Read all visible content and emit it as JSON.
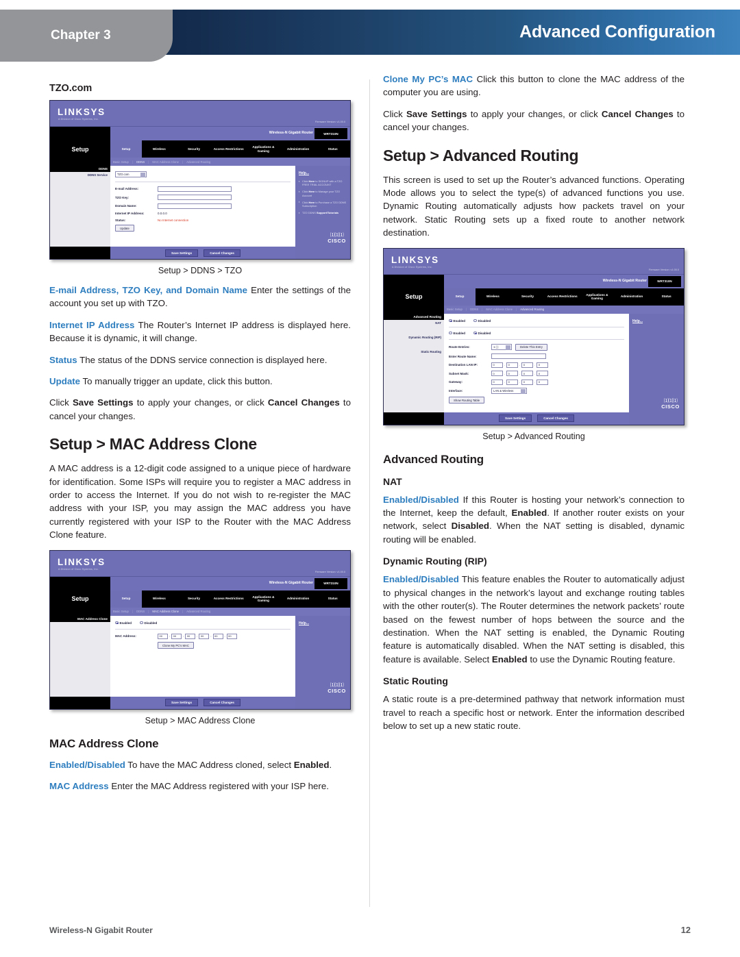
{
  "header": {
    "chapter_label": "Chapter 3",
    "banner_title": "Advanced Configuration",
    "banner_gradient_start": "#12294a",
    "banner_gradient_end": "#3d82bd",
    "chapter_tab_color": "#939598"
  },
  "theme": {
    "accent_blue": "#2e7ebf",
    "body_text": "#231f20",
    "router_purple": "#6f6fb5",
    "status_red": "#d8361f"
  },
  "left_column": {
    "tzo_heading": "TZO.com",
    "tzo_caption": "Setup > DDNS > TZO",
    "p_email": {
      "lead": "E-mail Address, TZO Key, and Domain Name",
      "rest": " Enter the settings of the account you set up with TZO."
    },
    "p_internet_ip": {
      "lead": "Internet IP Address",
      "rest": " The Router’s Internet IP address is displayed here. Because it is dynamic, it will change."
    },
    "p_status": {
      "lead": "Status",
      "rest": " The status of the DDNS service connection is displayed here."
    },
    "p_update": {
      "lead": "Update",
      "rest": "  To manually trigger an update, click this button."
    },
    "p_save": {
      "pre": "Click ",
      "b1": "Save Settings",
      "mid": " to apply your changes, or click ",
      "b2": "Cancel Changes",
      "post": " to cancel your changes."
    },
    "mac_clone_heading": "Setup > MAC Address Clone",
    "mac_clone_intro": "A MAC address is a 12-digit code assigned to a unique piece of hardware for identification. Some ISPs will require you to register a MAC address in order to access the Internet. If you do not wish to re-register the MAC address with your ISP, you may assign the MAC address you have currently registered with your ISP to the Router with the MAC Address Clone feature.",
    "mac_clone_caption": "Setup > MAC Address Clone",
    "mac_clone_subheading": "MAC Address Clone",
    "p_enabled_disabled": {
      "lead": "Enabled/Disabled",
      "mid": " To have the MAC Address cloned, select ",
      "b1": "Enabled",
      "post": "."
    },
    "p_mac_address": {
      "lead": "MAC Address",
      "rest": " Enter the MAC Address registered with your ISP here."
    }
  },
  "right_column": {
    "p_clone_my_pcs_mac": {
      "lead": "Clone My PC’s MAC",
      "rest": "  Click this button to clone the MAC address of the computer you are using."
    },
    "p_save": {
      "pre": "Click ",
      "b1": "Save Settings",
      "mid": " to apply your changes, or click ",
      "b2": "Cancel Changes",
      "post": " to cancel your changes."
    },
    "adv_routing_heading": "Setup > Advanced Routing",
    "adv_routing_intro": "This screen is used to set up the Router’s advanced functions. Operating Mode allows you to select the type(s) of advanced functions you use. Dynamic Routing automatically adjusts how packets travel on your network. Static Routing sets up a fixed route to another network destination.",
    "adv_routing_caption": "Setup > Advanced Routing",
    "adv_routing_subheading": "Advanced Routing",
    "nat_heading": "NAT",
    "p_nat": {
      "lead": "Enabled/Disabled",
      "t1": "  If this Router is hosting your network’s connection to the Internet, keep the default, ",
      "b1": "Enabled",
      "t2": ". If another router exists on your network, select ",
      "b2": "Disabled",
      "t3": ". When the NAT setting is disabled, dynamic routing will be enabled."
    },
    "rip_heading": "Dynamic Routing (RIP)",
    "p_rip": {
      "lead": "Enabled/Disabled",
      "t1": " This feature enables the Router to automatically adjust to physical changes in the network’s layout and exchange routing tables with the other router(s). The Router determines the network packets’ route based on the fewest number of hops between the source and the destination. When the NAT setting is enabled, the Dynamic Routing feature is automatically disabled. When the NAT setting is disabled, this feature is available. Select ",
      "b1": "Enabled",
      "t2": " to use the Dynamic Routing feature."
    },
    "static_routing_heading": "Static Routing",
    "p_static_routing": "A static route is a pre-determined pathway that network information must travel to reach a specific host or network. Enter the information described below to set up a new static route."
  },
  "router_ui": {
    "brand": "LINKSYS",
    "brand_sub": "A Division of Cisco Systems, Inc.",
    "firmware": "Firmware Version: v1.00.0",
    "product_name": "Wireless-N Gigabit Router",
    "model": "WRT310N",
    "section_title": "Setup",
    "tabs": [
      "Setup",
      "Wireless",
      "Security",
      "Access Restrictions",
      "Applications & Gaming",
      "Administration",
      "Status"
    ],
    "subnav": [
      "Basic Setup",
      "DDNS",
      "MAC Address Clone",
      "Advanced Routing"
    ],
    "save_button": "Save Settings",
    "cancel_button": "Cancel Changes",
    "help_title": "Help...",
    "cisco_word": "CISCO"
  },
  "tzo_screen": {
    "side_heading": "DDNS",
    "side_label": "DDNS Service",
    "service_select": "TZO.com",
    "fields": [
      {
        "label": "E-mail Address:",
        "value": ""
      },
      {
        "label": "TZO Key:",
        "value": ""
      },
      {
        "label": "Domain Name:",
        "value": ""
      }
    ],
    "internet_ip_label": "Internet IP Address:",
    "internet_ip_value": "0.0.0.0",
    "status_label": "Status:",
    "status_value": "No Internet connection",
    "update_button": "Update",
    "help_items": [
      {
        "pre": "Click ",
        "b": "Here",
        "post": " to SIGNUP with a TZO FREE TRIAL ACCOUNT"
      },
      {
        "pre": "Click ",
        "b": "Here",
        "post": " to Manage your TZO Account"
      },
      {
        "pre": "Click ",
        "b": "Here",
        "post": " to Purchase a TZO DDNS Subscription"
      },
      {
        "pre": "TZO DDNS ",
        "b": "Support/Tutorials",
        "post": ""
      }
    ]
  },
  "mac_clone_screen": {
    "side_heading": "MAC Address Clone",
    "radio_enabled": "Enabled",
    "radio_disabled": "Disabled",
    "mac_label": "MAC Address:",
    "octets": [
      "00",
      "00",
      "00",
      "00",
      "00",
      "00"
    ],
    "clone_button": "Clone My PC's MAC",
    "help_title": "Help..."
  },
  "adv_routing_screen": {
    "side_heading": "Advanced Routing",
    "side_label_nat": "NAT",
    "side_label_rip": "Dynamic Routing (RIP)",
    "side_label_static": "Static Routing",
    "nat_enabled": "Enabled",
    "nat_disabled": "Disabled",
    "rip_enabled": "Enabled",
    "rip_disabled": "Disabled",
    "route_entries_label": "Route Entries:",
    "route_entries_value": "1 ( )",
    "delete_button": "Delete This Entry",
    "route_name_label": "Enter Route Name:",
    "dest_lan_label": "Destination LAN IP:",
    "subnet_label": "Subnet Mask:",
    "gateway_label": "Gateway:",
    "interface_label": "Interface:",
    "interface_value": "LAN & Wireless",
    "ip_octets": [
      "0",
      "0",
      "0",
      "0"
    ],
    "show_routing_button": "Show Routing Table",
    "help_title": "Help..."
  },
  "footer": {
    "label": "Wireless-N Gigabit Router",
    "page_number": "12"
  }
}
